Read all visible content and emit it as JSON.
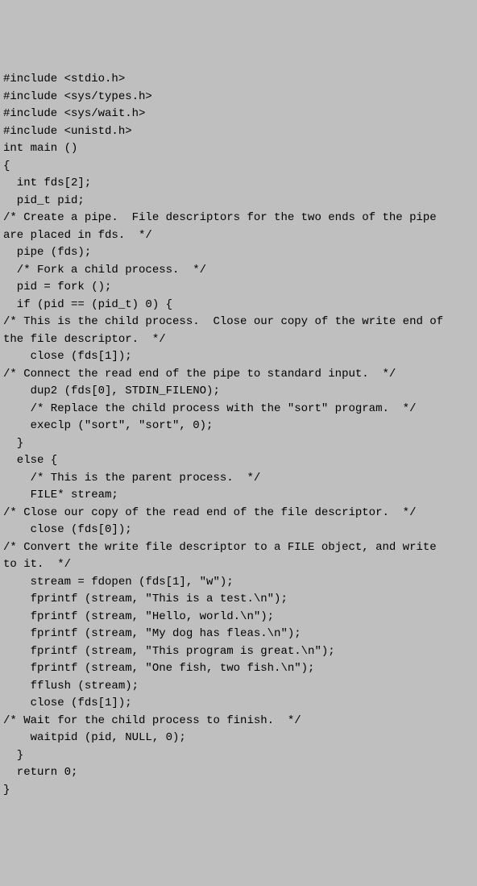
{
  "code": {
    "lines": [
      "#include <stdio.h>",
      "#include <sys/types.h>",
      "#include <sys/wait.h>",
      "#include <unistd.h>",
      "int main ()",
      "{",
      "  int fds[2];",
      "  pid_t pid;",
      "/* Create a pipe.  File descriptors for the two ends of the pipe",
      "are placed in fds.  */",
      "  pipe (fds);",
      "  /* Fork a child process.  */",
      "  pid = fork ();",
      "  if (pid == (pid_t) 0) {",
      "/* This is the child process.  Close our copy of the write end of",
      "the file descriptor.  */",
      "    close (fds[1]);",
      "/* Connect the read end of the pipe to standard input.  */",
      "    dup2 (fds[0], STDIN_FILENO);",
      "    /* Replace the child process with the \"sort\" program.  */",
      "    execlp (\"sort\", \"sort\", 0);",
      "  }",
      "  else {",
      "    /* This is the parent process.  */",
      "    FILE* stream;",
      "/* Close our copy of the read end of the file descriptor.  */",
      "    close (fds[0]);",
      "/* Convert the write file descriptor to a FILE object, and write",
      "to it.  */",
      "    stream = fdopen (fds[1], \"w\");",
      "    fprintf (stream, \"This is a test.\\n\");",
      "    fprintf (stream, \"Hello, world.\\n\");",
      "    fprintf (stream, \"My dog has fleas.\\n\");",
      "    fprintf (stream, \"This program is great.\\n\");",
      "    fprintf (stream, \"One fish, two fish.\\n\");",
      "    fflush (stream);",
      "    close (fds[1]);",
      "/* Wait for the child process to finish.  */",
      "    waitpid (pid, NULL, 0);",
      "  }",
      "  return 0;",
      "}"
    ]
  }
}
